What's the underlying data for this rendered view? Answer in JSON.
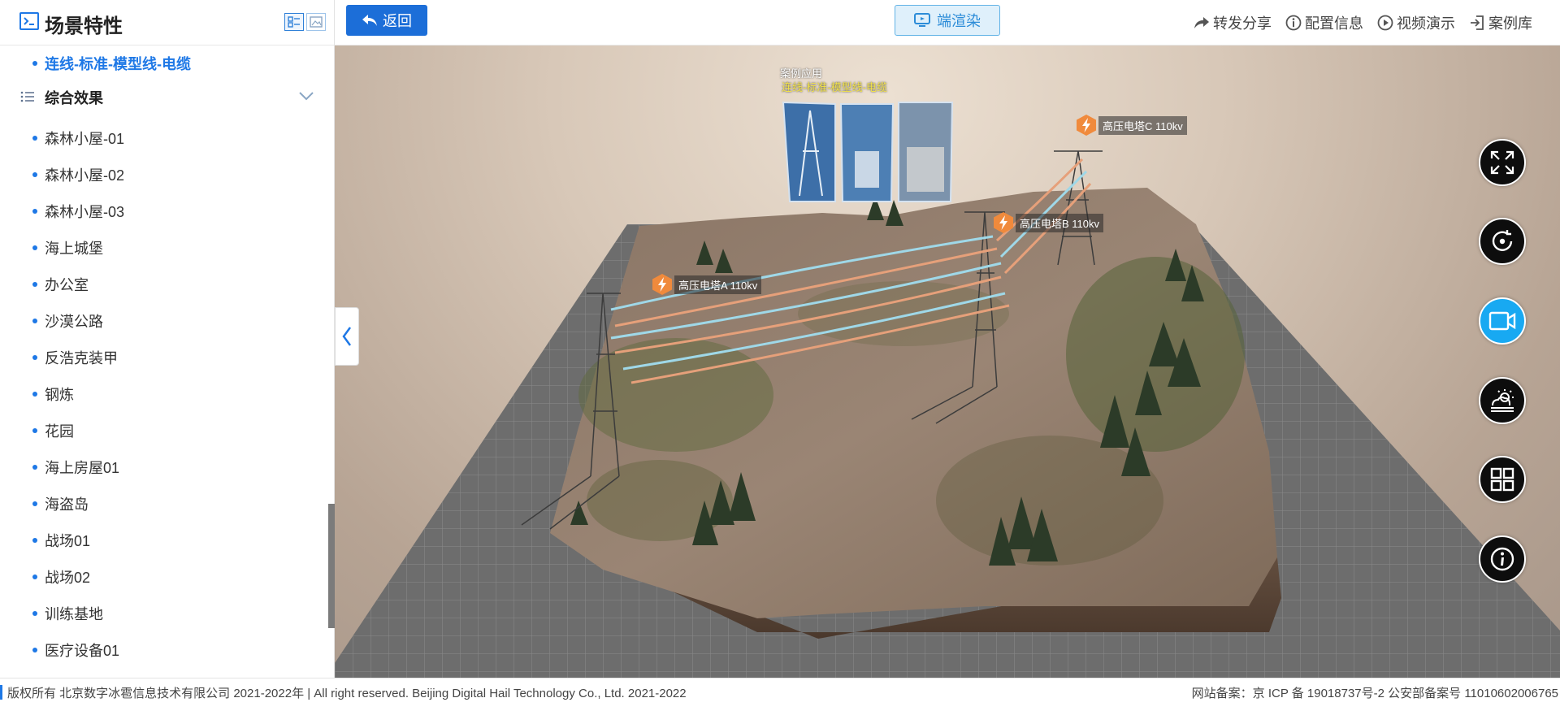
{
  "sidebar": {
    "title": "场景特性",
    "selected_item": "连线-标准-模型线-电缆",
    "group": {
      "label": "综合效果"
    },
    "items": [
      {
        "label": "森林小屋-01"
      },
      {
        "label": "森林小屋-02"
      },
      {
        "label": "森林小屋-03"
      },
      {
        "label": "海上城堡"
      },
      {
        "label": "办公室"
      },
      {
        "label": "沙漠公路"
      },
      {
        "label": "反浩克装甲"
      },
      {
        "label": "钢炼"
      },
      {
        "label": "花园"
      },
      {
        "label": "海上房屋01"
      },
      {
        "label": "海盗岛"
      },
      {
        "label": "战场01"
      },
      {
        "label": "战场02"
      },
      {
        "label": "训练基地"
      },
      {
        "label": "医疗设备01"
      }
    ]
  },
  "topbar": {
    "back_label": "返回",
    "render_label": "端渲染",
    "links": {
      "share": "转发分享",
      "config": "配置信息",
      "video": "视频演示",
      "cases": "案例库"
    }
  },
  "viewport": {
    "case_title": "案例应用",
    "case_subtitle": "连线-标准-模型线-电缆",
    "towers": {
      "a": "高压电塔A  110kv",
      "b": "高压电塔B  110kv",
      "c": "高压电塔C  110kv"
    },
    "tools": [
      "fullscreen-icon",
      "rotate-icon",
      "camera-icon",
      "weather-icon",
      "grid-icon",
      "info-icon"
    ]
  },
  "footer": {
    "copyright": "版权所有 北京数字冰雹信息技术有限公司 2021-2022年 | All right reserved. Beijing Digital Hail Technology Co., Ltd. 2021-2022",
    "icp": "网站备案：京 ICP 备 19018737号-2 公安部备案号 11010602006765"
  },
  "colors": {
    "accent": "#1e78e6",
    "primary_button": "#1c6ed8",
    "active_tool": "#18a9f2"
  }
}
